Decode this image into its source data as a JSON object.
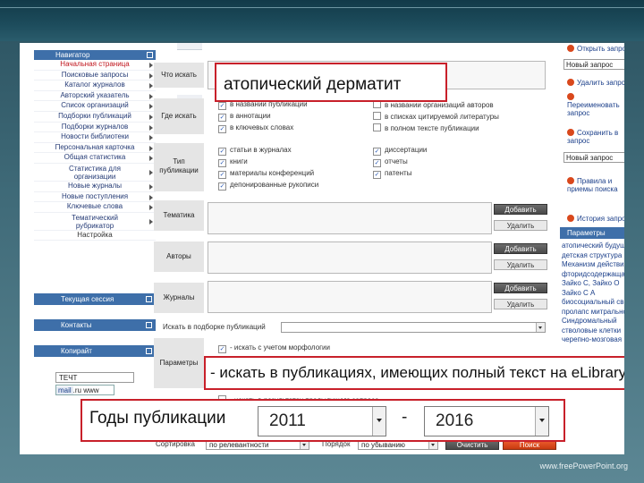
{
  "footer": "www.freePowerPoint.org",
  "nav": {
    "header": "Навигатор",
    "items": [
      "Начальная страница",
      "Поисковые запросы",
      "Каталог журналов",
      "Авторский указатель",
      "Список организаций",
      "Подборки публикаций",
      "Подборки журналов",
      "Новости библиотеки",
      "Персональная карточка",
      "Общая статистика"
    ],
    "stat_org": [
      "Статистика для",
      "организации"
    ],
    "items2": [
      "Новые журналы",
      "Новые поступления",
      "Ключевые слова"
    ],
    "rubricator": [
      "Тематический",
      "рубрикатор"
    ],
    "settings": "Настройка",
    "sections": [
      "Текущая сессия",
      "Контакты",
      "Копирайт"
    ],
    "badge1": "ТЕЧТ",
    "badge2_mail": "mail",
    "badge2_ru": ".ru",
    "badge2_rest": "www"
  },
  "form": {
    "what_label": "Что искать",
    "where_label": "Где искать",
    "where_options": [
      {
        "label": "в названии публикации",
        "checked": true
      },
      {
        "label": "в аннотации",
        "checked": true
      },
      {
        "label": "в ключевых словах",
        "checked": true
      }
    ],
    "where_options_right": [
      {
        "label": "в названии организаций авторов",
        "checked": false
      },
      {
        "label": "в списках цитируемой литературы",
        "checked": false
      },
      {
        "label": "в полном тексте публикации",
        "checked": false
      }
    ],
    "type_label": "Тип публикации",
    "type_options": [
      {
        "label": "статьи в журналах",
        "checked": true
      },
      {
        "label": "книги",
        "checked": true
      },
      {
        "label": "материалы конференций",
        "checked": true
      },
      {
        "label": "депонированные рукописи",
        "checked": true
      }
    ],
    "type_options_right": [
      {
        "label": "диссертации",
        "checked": true
      },
      {
        "label": "отчеты",
        "checked": true
      },
      {
        "label": "патенты",
        "checked": true
      }
    ],
    "topic_label": "Тематика",
    "authors_label": "Авторы",
    "journals_label": "Журналы",
    "add": "Добавить",
    "remove": "Удалить",
    "collection_label": "Искать в подборке публикаций",
    "params_label": "Параметры",
    "morphology": "- искать с учетом морфологии",
    "in_results": "- искать в результатах предыдущего запроса",
    "sort_label": "Сортировка",
    "sort_value": "по релевантности",
    "order_label": "Порядок",
    "order_value": "по убыванию",
    "clear": "Очистить",
    "search": "Поиск"
  },
  "callouts": {
    "query": "атопический дерматит",
    "fulltext": "- искать в публикациях, имеющих полный текст на eLibrary.Ru",
    "years_label": "Годы публикации",
    "year_from": "2011",
    "dash": "-",
    "year_to": "2016"
  },
  "right": {
    "open_query": "Открыть запрос",
    "new_query_1": "Новый запрос",
    "delete_query": "Удалить запрос",
    "rename_query": "Переименовать запрос",
    "save_query": "Сохранить в запрос",
    "new_query_2": "Новый запрос",
    "rules": "Правила и приемы поиска",
    "history": "История запросов",
    "params_header": "Параметры запроса",
    "history_items": [
      "атопический будущего преподавателя",
      "детская структура",
      "Механизм действия",
      "фторидсодержащая паста",
      "Зайко С, Зайко О",
      "Зайко С А",
      "биосоциальный свинец",
      "пролапс митрального",
      "Синдромальный",
      "стволовые клетки",
      "черепно-мозговая"
    ]
  }
}
